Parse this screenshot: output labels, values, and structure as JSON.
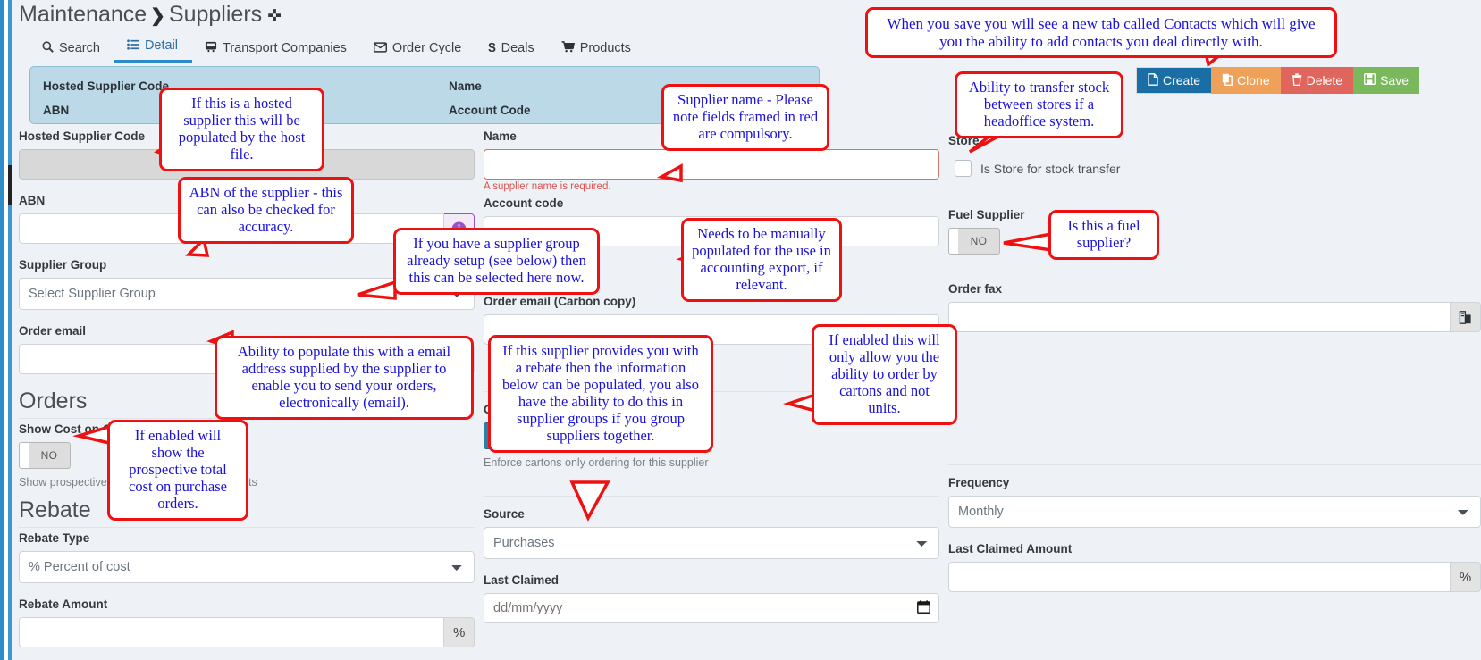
{
  "breadcrumb": {
    "root": "Maintenance",
    "sep": "❯",
    "current": "Suppliers",
    "pin": "✜"
  },
  "tabs": [
    {
      "label": "Search",
      "icon": "search-icon",
      "glyph": "🔍",
      "active": false
    },
    {
      "label": "Detail",
      "icon": "list-icon",
      "glyph": "☰",
      "active": true
    },
    {
      "label": "Transport Companies",
      "icon": "truck-icon",
      "glyph": "🚚",
      "active": false
    },
    {
      "label": "Order Cycle",
      "icon": "envelope-icon",
      "glyph": "✉",
      "active": false
    },
    {
      "label": "Deals",
      "icon": "dollar-icon",
      "glyph": "$",
      "active": false
    },
    {
      "label": "Products",
      "icon": "cart-icon",
      "glyph": "🛒",
      "active": false
    }
  ],
  "summary": {
    "hosted_supplier_code": "Hosted Supplier Code",
    "abn": "ABN",
    "name": "Name",
    "account_code": "Account Code"
  },
  "toolbar": {
    "create": "Create",
    "clone": "Clone",
    "delete": "Delete",
    "save": "Save"
  },
  "colors": {
    "create": "#1b6ea5",
    "clone": "#efa15a",
    "delete": "#e0655c",
    "save": "#79b95c",
    "callout_border": "#ee1111",
    "callout_text": "#1a12d8",
    "summary_bg": "#bcd9e8",
    "toggle_on": "#2980a8"
  },
  "form": {
    "hosted_supplier_code_label": "Hosted Supplier Code",
    "hosted_supplier_code_value": "",
    "abn_label": "ABN",
    "abn_value": "",
    "abn_info_icon": "info-icon",
    "supplier_group_label": "Supplier Group",
    "supplier_group_value": "Select Supplier Group",
    "order_email_label": "Order email",
    "order_email_value": "",
    "name_label": "Name",
    "name_value": "",
    "name_error": "A supplier name is required.",
    "account_code_label": "Account code",
    "account_code_value": "",
    "order_email_cc_label": "Order email (Carbon copy)",
    "order_email_cc_value": "",
    "order_fax_label": "Order fax",
    "order_fax_value": "",
    "order_fax_addon_icon": "fax-icon",
    "store_label": "Store",
    "store_checkbox_label": "Is Store for stock transfer",
    "store_checked": false,
    "fuel_supplier_label": "Fuel Supplier",
    "fuel_supplier_toggle": "NO",
    "fuel_supplier_on": false
  },
  "orders": {
    "heading": "Orders",
    "show_cost_label": "Show Cost on Orders",
    "show_cost_toggle": "NO",
    "show_cost_on": false,
    "show_cost_hint": "Show prospective total cost on order documents",
    "cartons_only_label": "Cartons Only",
    "cartons_only_toggle": "YES",
    "cartons_only_on": true,
    "cartons_only_hint": "Enforce cartons only ordering for this supplier"
  },
  "rebate": {
    "heading": "Rebate",
    "rebate_type_label": "Rebate Type",
    "rebate_type_value": "% Percent of cost",
    "rebate_amount_label": "Rebate Amount",
    "rebate_amount_value": "",
    "rebate_amount_addon": "%",
    "source_label": "Source",
    "source_value": "Purchases",
    "last_claimed_label": "Last Claimed",
    "last_claimed_placeholder": "dd/mm/yyyy",
    "last_claimed_value": "",
    "frequency_label": "Frequency",
    "frequency_value": "Monthly",
    "last_claimed_amount_label": "Last Claimed Amount",
    "last_claimed_amount_value": "",
    "last_claimed_amount_addon": "%"
  },
  "callouts": {
    "contacts_tab": "When you save you will see a new tab called Contacts which will give you the ability to add contacts you deal directly with.",
    "hosted_supplier": "If this is a hosted supplier this will be populated by the host file.",
    "abn": "ABN of the supplier - this can also be checked for accuracy.",
    "supplier_name": "Supplier name - Please note fields framed in red are compulsory.",
    "stock_transfer": "Ability to transfer stock between stores if a headoffice system.",
    "supplier_group": "If you have a supplier group already setup (see below) then this can be selected here now.",
    "account_code": "Needs to be manually populated for the use in accounting export, if relevant.",
    "fuel_supplier": "Is this a fuel supplier?",
    "order_email": "Ability to populate this with a email address supplied by the supplier to enable you to send your orders, electronically (email).",
    "rebate_info": "If this supplier provides you with a rebate then the information below can be populated, you also have the ability to do this in supplier groups if you group suppliers together.",
    "cartons_only": "If enabled this will only allow you the ability to order by cartons and not units.",
    "show_cost": "If enabled will show the prospective total cost on purchase orders."
  }
}
